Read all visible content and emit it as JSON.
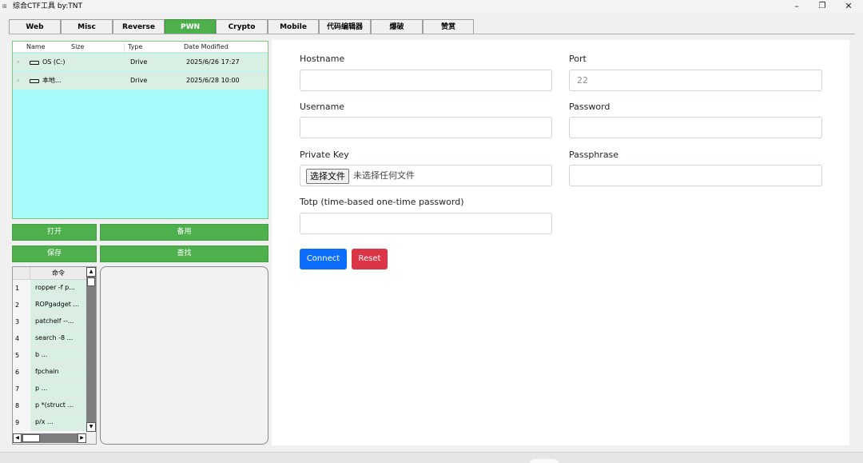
{
  "window": {
    "title": "综合CTF工具   by:TNT",
    "minimize_glyph": "–",
    "maximize_glyph": "❐",
    "close_glyph": "✕"
  },
  "tabs": [
    {
      "label": "Web"
    },
    {
      "label": "Misc"
    },
    {
      "label": "Reverse"
    },
    {
      "label": "PWN",
      "active": true
    },
    {
      "label": "Crypto"
    },
    {
      "label": "Mobile"
    },
    {
      "label": "代码编辑器"
    },
    {
      "label": "爆破"
    },
    {
      "label": "赞赏"
    }
  ],
  "explorer": {
    "columns": {
      "name": "Name",
      "size": "Size",
      "type": "Type",
      "date": "Date Modified"
    },
    "rows": [
      {
        "name": "OS (C:)",
        "type": "Drive",
        "date": "2025/6/26 17:27"
      },
      {
        "name": "本地...",
        "type": "Drive",
        "date": "2025/6/28 10:00"
      }
    ],
    "background_color": "#a6fafa"
  },
  "buttons": {
    "open": "打开",
    "backup": "备用",
    "save": "保存",
    "find": "查找"
  },
  "commands": {
    "header": "命令",
    "items": [
      {
        "num": "1",
        "text": "ropper -f p..."
      },
      {
        "num": "2",
        "text": "ROPgadget ..."
      },
      {
        "num": "3",
        "text": "patchelf --..."
      },
      {
        "num": "4",
        "text": "search -8 ..."
      },
      {
        "num": "5",
        "text": "b ..."
      },
      {
        "num": "6",
        "text": "fpchain"
      },
      {
        "num": "7",
        "text": "p ..."
      },
      {
        "num": "8",
        "text": "p *(struct ..."
      },
      {
        "num": "9",
        "text": "p/x ..."
      }
    ]
  },
  "ssh_form": {
    "hostname": {
      "label": "Hostname",
      "value": ""
    },
    "port": {
      "label": "Port",
      "placeholder": "22"
    },
    "username": {
      "label": "Username",
      "value": ""
    },
    "password": {
      "label": "Password",
      "value": ""
    },
    "private_key": {
      "label": "Private Key",
      "button": "选择文件",
      "status": "未选择任何文件"
    },
    "passphrase": {
      "label": "Passphrase",
      "value": ""
    },
    "totp": {
      "label": "Totp (time-based one-time password)",
      "value": ""
    },
    "connect": "Connect",
    "reset": "Reset"
  },
  "colors": {
    "accent_green": "#4db04d",
    "connect_blue": "#0d6efd",
    "reset_red": "#dc3545"
  }
}
